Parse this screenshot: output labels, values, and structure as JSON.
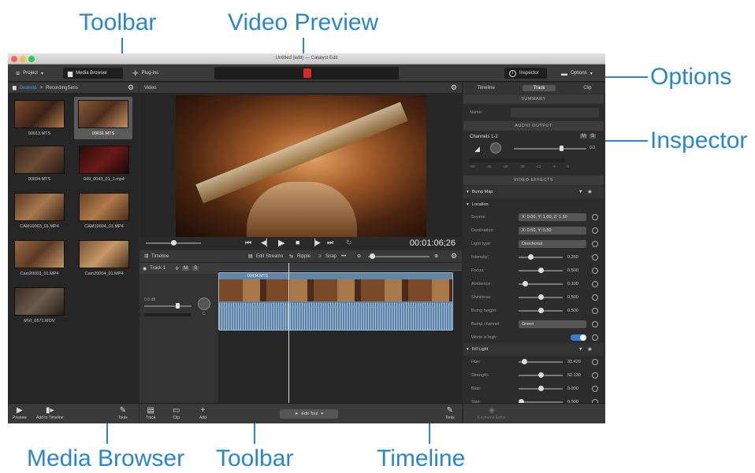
{
  "callouts": {
    "toolbar_top": "Toolbar",
    "video_preview": "Video Preview",
    "options": "Options",
    "inspector": "Inspector",
    "media_browser": "Media Browser",
    "toolbar_bottom": "Toolbar",
    "timeline": "Timeline"
  },
  "window": {
    "title": "Untitled (edit) — Catalyst Edit"
  },
  "toolbar": {
    "project": "Project",
    "media_browser": "Media Browser",
    "plugins": "Plug-ins",
    "inspector": "Inspector",
    "options": "Options"
  },
  "browser": {
    "path_root": "Desktop",
    "path_sep": ">",
    "path_leaf": "RecordingSess",
    "items": [
      {
        "label": "00013.MTS"
      },
      {
        "label": "00031.MTS"
      },
      {
        "label": "00034.MTS"
      },
      {
        "label": "049_0043_01_1.mp4"
      },
      {
        "label": "CAM10003_01.MP4"
      },
      {
        "label": "CAM10004_01.MP4"
      },
      {
        "label": "Cam20003_01.MP4"
      },
      {
        "label": "Cam20004_01.MP4"
      },
      {
        "label": "MVI_0571.MOV"
      }
    ]
  },
  "video": {
    "header": "Video",
    "timecode": "00:01:06;26"
  },
  "timeline": {
    "header": "Timeline",
    "edit_streams": "Edit Streams",
    "ripple": "Ripple",
    "snap": "Snap",
    "track_name": "Track 1",
    "m": "M",
    "s": "S",
    "clip_name": "00034.MTS",
    "level": "0.0 dB",
    "pan": "C"
  },
  "inspector": {
    "tabs": [
      "Timeline",
      "Track",
      "Clip"
    ],
    "summary": "SUMMARY",
    "name_label": "Name:",
    "audio_output": "AUDIO OUTPUT",
    "channels": "Channels 1-2",
    "m": "M",
    "s": "S",
    "gain": "0.0",
    "meter_scale": [
      "-60",
      "-45",
      "-30",
      "-20",
      "-12",
      "-6",
      "0"
    ],
    "video_effects": "VIDEO EFFECTS",
    "bump_map": "Bump Map",
    "location": "Location",
    "rows": [
      {
        "label": "Source:",
        "value": "X: 0.00, Y: 1.00, Z: 1.50"
      },
      {
        "label": "Destination:",
        "value": "X: 0.50, Y: 0.50"
      },
      {
        "label": "Light type:",
        "value": "Directional"
      },
      {
        "label": "Intensity:",
        "value": "0.250",
        "level": 0.25
      },
      {
        "label": "Focus:",
        "value": "0.500",
        "level": 0.5
      },
      {
        "label": "Ambience:",
        "value": "0.100",
        "level": 0.1
      },
      {
        "label": "Shininess:",
        "value": "0.500",
        "level": 0.5
      },
      {
        "label": "Bump height:",
        "value": "0.500",
        "level": 0.5
      },
      {
        "label": "Bump channel:",
        "value": "Green"
      },
      {
        "label": "White is high:",
        "value": "On"
      }
    ],
    "fill_light": "Fill Light",
    "fill_rows": [
      {
        "label": "Hue:",
        "value": "33.420",
        "level": 0.09
      },
      {
        "label": "Strength:",
        "value": "52.130",
        "level": 0.52
      },
      {
        "label": "Bias:",
        "value": "0.000",
        "level": 0.5
      },
      {
        "label": "Size:",
        "value": "0.000",
        "level": 0.0
      }
    ]
  },
  "bottom": {
    "preview": "Preview",
    "add_to_timeline": "Add to Timeline",
    "tools_left": "Tools",
    "track": "Track",
    "clip": "Clip",
    "add": "Add",
    "edit_tool": "Edit Tool",
    "tools_right": "Tools",
    "keyframe_editor": "Keyframe Editor"
  },
  "colors": {
    "accent": "#2a86c9",
    "app_bg": "#2b2b2b",
    "track_clip": "#5f86a8"
  }
}
